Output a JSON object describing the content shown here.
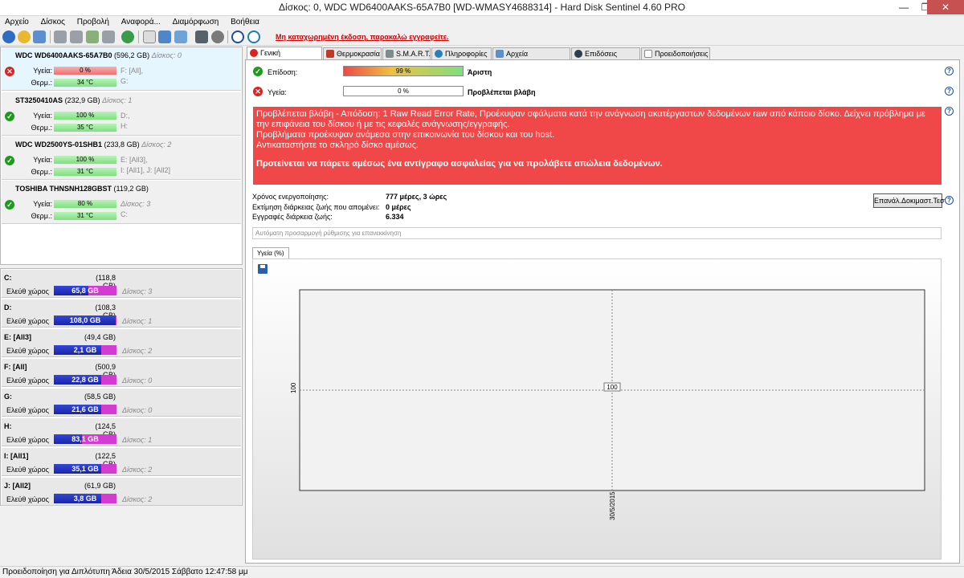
{
  "window": {
    "title": "Δίσκος: 0, WDC WD6400AAKS-65A7B0 [WD-WMASY4688314]  -  Hard Disk Sentinel 4.60 PRO",
    "minimize": "—",
    "maximize": "❐",
    "close": "✕"
  },
  "menu": [
    "Αρχείο",
    "Δίσκος",
    "Προβολή",
    "Αναφορά...",
    "Διαμόρφωση",
    "Βοήθεια"
  ],
  "toolbar": {
    "unregistered": "Μη καταχωρημένη έκδοση, παρακαλώ εγγραφείτε.",
    "icons": [
      "refresh-icon",
      "disk-info-icon",
      "report-icon",
      "tool-icon-1",
      "tool-icon-2",
      "tool-icon-3",
      "tool-icon-4",
      "globe-icon",
      "page-icon",
      "settings-icon",
      "network-icon",
      "monitor-icon",
      "gear-icon",
      "help-icon",
      "info-icon"
    ]
  },
  "disks": [
    {
      "name": "WDC WD6400AAKS-65A7B0",
      "size": "(596,2 GB)",
      "num": "Δίσκος: 0",
      "health_label": "Υγεία:",
      "health": "0 %",
      "health_pct": 0,
      "temp_label": "Θερμ.:",
      "temp": "34 °C",
      "status": "bad",
      "parts1": "F: [All],",
      "parts2": "G:"
    },
    {
      "name": "ST3250410AS",
      "size": "(232,9 GB)",
      "num": "Δίσκος: 1",
      "health_label": "Υγεία:",
      "health": "100 %",
      "health_pct": 100,
      "temp_label": "Θερμ.:",
      "temp": "35 °C",
      "status": "ok",
      "parts1": "D:,",
      "parts2": "H:"
    },
    {
      "name": "WDC WD2500YS-01SHB1",
      "size": "(233,8 GB)",
      "num": "Δίσκος: 2",
      "health_label": "Υγεία:",
      "health": "100 %",
      "health_pct": 100,
      "temp_label": "Θερμ.:",
      "temp": "31 °C",
      "status": "ok",
      "parts1": "E: [All3],",
      "parts2": "I: [All1], J: [All2]"
    },
    {
      "name": "TOSHIBA THNSNH128GBST",
      "size": "(119,2 GB)",
      "num": "Δίσκος: 3",
      "health_label": "Υγεία:",
      "health": "80 %",
      "health_pct": 80,
      "temp_label": "Θερμ.:",
      "temp": "31 °C",
      "status": "ok",
      "parts1": "",
      "parts2": "C:"
    }
  ],
  "volumes_free_label": "Ελεύθ χώρος",
  "volumes": [
    {
      "name": "C:",
      "size": "(118,8 GB)",
      "free": "65,8 GB",
      "free_pct": 55,
      "disk": "Δίσκος: 3"
    },
    {
      "name": "D:",
      "size": "(108,3 GB)",
      "free": "108,0 GB",
      "free_pct": 99,
      "disk": "Δίσκος: 1"
    },
    {
      "name": "E: [All3]",
      "size": "(49,4 GB)",
      "free": "2,1 GB",
      "free_pct": 75,
      "disk": "Δίσκος: 2"
    },
    {
      "name": "F: [All]",
      "size": "(500,9 GB)",
      "free": "22,8 GB",
      "free_pct": 75,
      "disk": "Δίσκος: 0"
    },
    {
      "name": "G:",
      "size": "(58,5 GB)",
      "free": "21,6 GB",
      "free_pct": 75,
      "disk": "Δίσκος: 0"
    },
    {
      "name": "H:",
      "size": "(124,5 GB)",
      "free": "83,1 GB",
      "free_pct": 45,
      "disk": "Δίσκος: 1"
    },
    {
      "name": "I: [All1]",
      "size": "(122,5 GB)",
      "free": "35,1 GB",
      "free_pct": 75,
      "disk": "Δίσκος: 2"
    },
    {
      "name": "J: [All2]",
      "size": "(61,9 GB)",
      "free": "3,8 GB",
      "free_pct": 75,
      "disk": "Δίσκος: 2"
    }
  ],
  "tabs": [
    "Γενική επισκόπηση",
    "Θερμοκρασία",
    "S.M.A.R.T.",
    "Πληροφορίες",
    "Αρχεία Καταγραφής",
    "Επιδόσεις δίσκου",
    "Προειδοποιήσεις"
  ],
  "overview": {
    "perf_label": "Επίδοση:",
    "perf_value": "99 %",
    "perf_pct": 99,
    "perf_text": "Άριστη",
    "health_label": "Υγεία:",
    "health_value": "0 %",
    "health_pct": 0,
    "health_text": "Προβλέπεται βλάβη",
    "alert_lines": [
      "Προβλέπεται βλάβη - Απόδοση: 1 Raw Read Error Rate, Προέκυψαν σφάλματα κατά την ανάγνωση ακατέργαστων δεδομένων raw από κάποιο δίσκο. Δείχνει πρόβλημα με την επιφάνεια του δίσκου ή με τις κεφαλές ανάγνωσης/εγγραφής.",
      "Προβλήματα προέκυψαν ανάμεσα στην επικοινωνία του δίσκου και του host.",
      "Αντικαταστήστε το σκληρό δίσκο αμέσως."
    ],
    "alert_strong": "Προτείνεται να πάρετε αμέσως ένα αντίγραφο ασφαλείας για να προλάβετε απώλεια δεδομένων.",
    "power_on_label": "Χρόνος ενεργοποίησης:",
    "power_on_value": "777 μέρες, 3 ώρες",
    "life_label": "Εκτίμηση διάρκειας ζωής που απομένει:",
    "life_value": "0 μέρες",
    "writes_label": "Εγγραφές διάρκεια ζωής:",
    "writes_value": "6.334",
    "repeat_button": "Επανάλ.Δοκιμαστ.Τεστ",
    "auto_text": "Αυτόματη προσαρμογή ρύθμισης για επανεκκίνηση",
    "help_mark": "?"
  },
  "chart_tab": "Υγεία (%)",
  "chart_data": {
    "type": "line",
    "x": [
      "30/5/2015"
    ],
    "series": [
      {
        "values": [
          100
        ]
      }
    ],
    "ylabel": "100",
    "point_label": "100"
  },
  "statusbar": "Προειδοποίηση για Διπλότυπη  Άδεια 30/5/2015 Σάββατο 12:47:58 μμ",
  "colors": {
    "alert": "#f04848",
    "good": "#1e9a1e",
    "bad": "#d22222",
    "link": "#d40000"
  }
}
